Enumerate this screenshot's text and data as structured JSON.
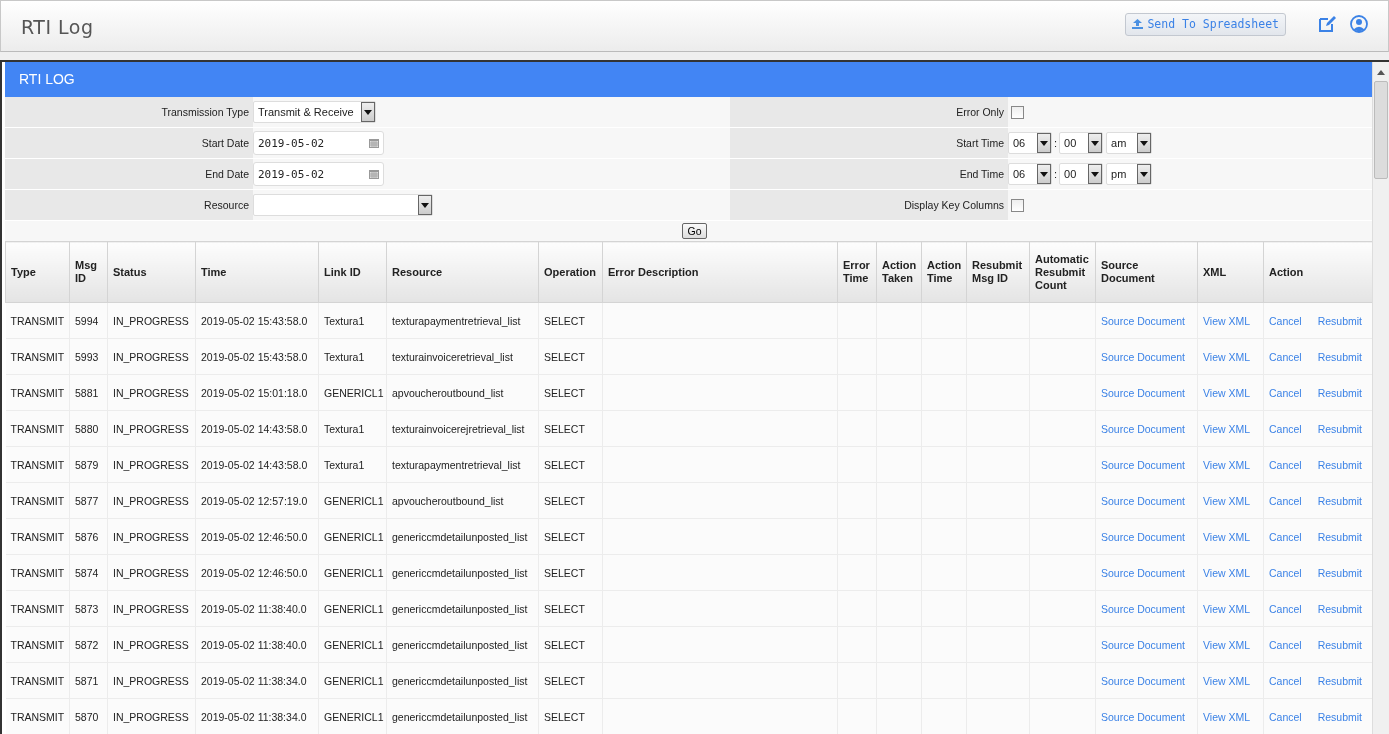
{
  "header": {
    "title": "RTI Log",
    "export_button": "Send To Spreadsheet"
  },
  "panel": {
    "title": "RTI LOG"
  },
  "filter_rows": [
    {
      "left": {
        "label": "Transmission Type",
        "kind": "select",
        "value": "Transmit & Receive"
      },
      "right": {
        "label": "Error Only",
        "kind": "checkbox",
        "checked": false
      }
    },
    {
      "left": {
        "label": "Start Date",
        "kind": "date",
        "value": "2019-05-02"
      },
      "right": {
        "label": "Start Time",
        "kind": "time",
        "hour": "06",
        "separator": ":",
        "minute": "00",
        "ampm": "am"
      }
    },
    {
      "left": {
        "label": "End Date",
        "kind": "date",
        "value": "2019-05-02"
      },
      "right": {
        "label": "End Time",
        "kind": "time",
        "hour": "06",
        "separator": ":",
        "minute": "00",
        "ampm": "pm"
      }
    },
    {
      "left": {
        "label": "Resource",
        "kind": "wideselect"
      },
      "right": {
        "label": "Display Key Columns",
        "kind": "checkbox",
        "checked": false
      }
    }
  ],
  "go_button": "Go",
  "table": {
    "columns": [
      "Type",
      "Msg ID",
      "Status",
      "Time",
      "Link ID",
      "Resource",
      "Operation",
      "Error Description",
      "Error Time",
      "Action Taken",
      "Action Time",
      "Resubmit Msg ID",
      "Automatic Resubmit Count",
      "Source Document",
      "XML",
      "Action"
    ],
    "rows": [
      {
        "cells": [
          "TRANSMIT",
          "5994",
          "IN_PROGRESS",
          "2019-05-02 15:43:58.0",
          "Textura1",
          "texturapaymentretrieval_list",
          "SELECT"
        ],
        "links": [
          "Source Document",
          "View XML",
          "Cancel",
          "Resubmit"
        ]
      },
      {
        "cells": [
          "TRANSMIT",
          "5993",
          "IN_PROGRESS",
          "2019-05-02 15:43:58.0",
          "Textura1",
          "texturainvoiceretrieval_list",
          "SELECT"
        ],
        "links": [
          "Source Document",
          "View XML",
          "Cancel",
          "Resubmit"
        ]
      },
      {
        "cells": [
          "TRANSMIT",
          "5881",
          "IN_PROGRESS",
          "2019-05-02 15:01:18.0",
          "GENERICL1",
          "apvoucheroutbound_list",
          "SELECT"
        ],
        "links": [
          "Source Document",
          "View XML",
          "Cancel",
          "Resubmit"
        ]
      },
      {
        "cells": [
          "TRANSMIT",
          "5880",
          "IN_PROGRESS",
          "2019-05-02 14:43:58.0",
          "Textura1",
          "texturainvoicerejretrieval_list",
          "SELECT"
        ],
        "links": [
          "Source Document",
          "View XML",
          "Cancel",
          "Resubmit"
        ]
      },
      {
        "cells": [
          "TRANSMIT",
          "5879",
          "IN_PROGRESS",
          "2019-05-02 14:43:58.0",
          "Textura1",
          "texturapaymentretrieval_list",
          "SELECT"
        ],
        "links": [
          "Source Document",
          "View XML",
          "Cancel",
          "Resubmit"
        ]
      },
      {
        "cells": [
          "TRANSMIT",
          "5877",
          "IN_PROGRESS",
          "2019-05-02 12:57:19.0",
          "GENERICL1",
          "apvoucheroutbound_list",
          "SELECT"
        ],
        "links": [
          "Source Document",
          "View XML",
          "Cancel",
          "Resubmit"
        ]
      },
      {
        "cells": [
          "TRANSMIT",
          "5876",
          "IN_PROGRESS",
          "2019-05-02 12:46:50.0",
          "GENERICL1",
          "genericcmdetailunposted_list",
          "SELECT"
        ],
        "links": [
          "Source Document",
          "View XML",
          "Cancel",
          "Resubmit"
        ]
      },
      {
        "cells": [
          "TRANSMIT",
          "5874",
          "IN_PROGRESS",
          "2019-05-02 12:46:50.0",
          "GENERICL1",
          "genericcmdetailunposted_list",
          "SELECT"
        ],
        "links": [
          "Source Document",
          "View XML",
          "Cancel",
          "Resubmit"
        ]
      },
      {
        "cells": [
          "TRANSMIT",
          "5873",
          "IN_PROGRESS",
          "2019-05-02 11:38:40.0",
          "GENERICL1",
          "genericcmdetailunposted_list",
          "SELECT"
        ],
        "links": [
          "Source Document",
          "View XML",
          "Cancel",
          "Resubmit"
        ]
      },
      {
        "cells": [
          "TRANSMIT",
          "5872",
          "IN_PROGRESS",
          "2019-05-02 11:38:40.0",
          "GENERICL1",
          "genericcmdetailunposted_list",
          "SELECT"
        ],
        "links": [
          "Source Document",
          "View XML",
          "Cancel",
          "Resubmit"
        ]
      },
      {
        "cells": [
          "TRANSMIT",
          "5871",
          "IN_PROGRESS",
          "2019-05-02 11:38:34.0",
          "GENERICL1",
          "genericcmdetailunposted_list",
          "SELECT"
        ],
        "links": [
          "Source Document",
          "View XML",
          "Cancel",
          "Resubmit"
        ]
      },
      {
        "cells": [
          "TRANSMIT",
          "5870",
          "IN_PROGRESS",
          "2019-05-02 11:38:34.0",
          "GENERICL1",
          "genericcmdetailunposted_list",
          "SELECT"
        ],
        "links": [
          "Source Document",
          "View XML",
          "Cancel",
          "Resubmit"
        ]
      }
    ]
  }
}
